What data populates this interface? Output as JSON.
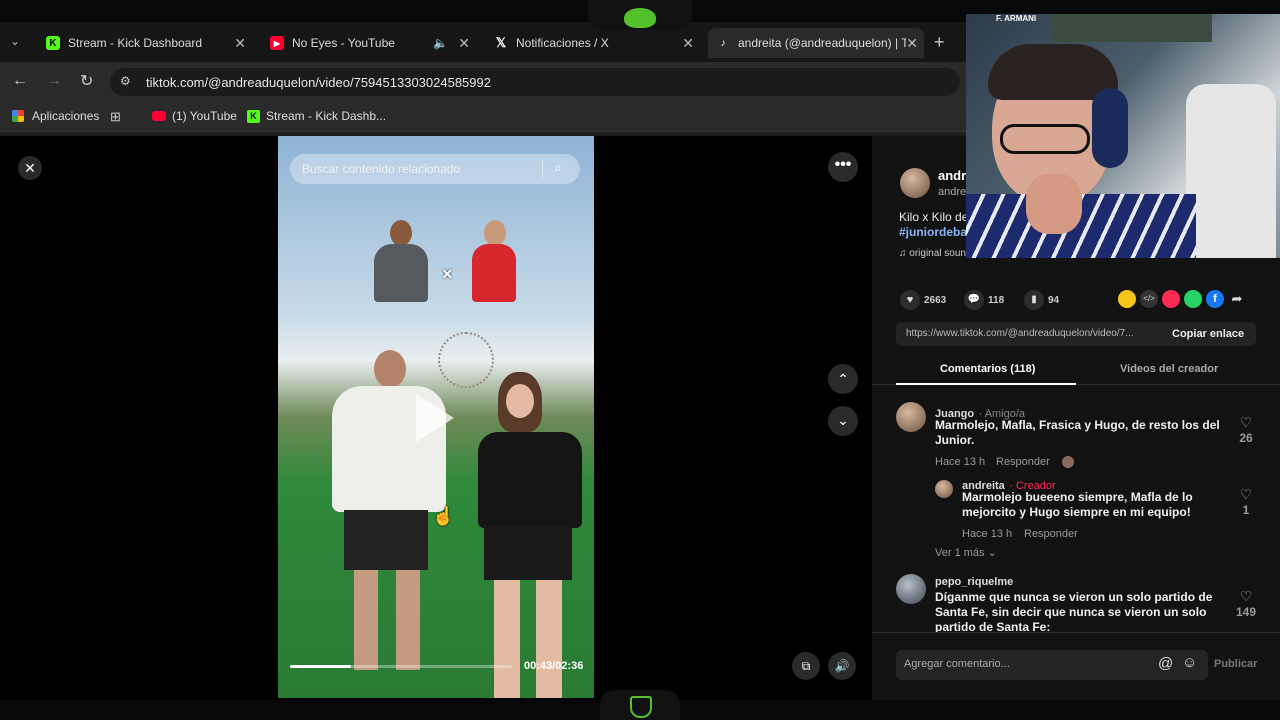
{
  "tabs": [
    {
      "label": "Stream - Kick Dashboard",
      "icon": "kick-icon"
    },
    {
      "label": "No Eyes - YouTube",
      "icon": "youtube-icon"
    },
    {
      "label": "Notificaciones / X",
      "icon": "x-icon"
    },
    {
      "label": "andreita (@andreaduquelon) | T",
      "icon": "tiktok-icon"
    }
  ],
  "url": "tiktok.com/@andreaduquelon/video/7594513303024585992",
  "bookmarks": [
    {
      "label": "Aplicaciones",
      "icon": "apps-grid-icon"
    },
    {
      "label": "",
      "icon": "grid-icon"
    },
    {
      "label": "(1) YouTube",
      "icon": "youtube-icon"
    },
    {
      "label": "Stream - Kick Dashb...",
      "icon": "kick-icon"
    }
  ],
  "video": {
    "search_placeholder": "Buscar contenido relacionado",
    "time": "00:43/02:36",
    "progress": 0.276,
    "versus_mark": "×"
  },
  "post": {
    "username": "andr",
    "handle": "andre",
    "caption": "Kilo x Kilo de",
    "hashtag": "#juniordeba",
    "sound": "original sound - andreita",
    "likes": "2663",
    "comments": "118",
    "saves": "94",
    "link": "https://www.tiktok.com/@andreaduquelon/video/7...",
    "copy_label": "Copiar enlace"
  },
  "side_tabs": [
    "Comentarios (118)",
    "Videos del creador"
  ],
  "comments": [
    {
      "name": "Juango",
      "tag": "· Amigo/a",
      "text": "Marmolejo, Mafla, Frasica y Hugo, de resto los del Junior.",
      "time": "Hace 13 h",
      "reply": "Responder",
      "likes": "26"
    },
    {
      "name": "andreita",
      "tag": "· Creador",
      "text": "Marmolejo bueeeno siempre, Mafla de lo mejorcito y Hugo siempre en mi equipo!",
      "time": "Hace 13 h",
      "reply": "Responder",
      "likes": "1"
    },
    {
      "name": "pepo_riquelme",
      "tag": "",
      "text": "Díganme que nunca se vieron un solo partido de Santa Fe, sin decir que nunca se vieron un solo partido de Santa Fe:",
      "time": "",
      "reply": "",
      "likes": "149"
    }
  ],
  "more_replies": "Ver 1 más",
  "comment_input": {
    "placeholder": "Agregar comentario...",
    "publish": "Publicar"
  },
  "overlay": {
    "streamer_label": "F. ARMANI"
  },
  "colors": {
    "accent": "#fe2c55",
    "kick_green": "#53fc18",
    "link_blue": "#8ab4f8"
  }
}
